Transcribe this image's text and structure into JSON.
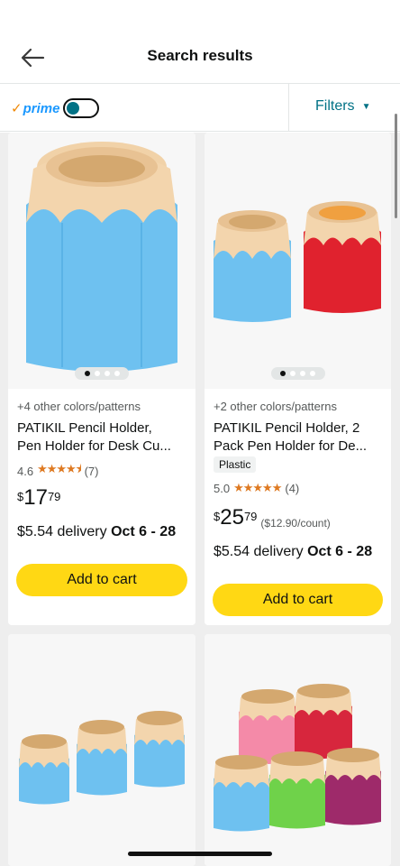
{
  "header": {
    "title": "Search results"
  },
  "filterbar": {
    "prime_check": "✓",
    "prime_label": "prime",
    "filters_label": "Filters"
  },
  "products": [
    {
      "variants": "+4 other colors/patterns",
      "title_line1": "PATIKIL Pencil Holder,",
      "title_line2": "Pen Holder for Desk Cu...",
      "rating": "4.6",
      "stars": "★★★★⯨",
      "reviews": "(7)",
      "price_currency": "$",
      "price_whole": "17",
      "price_fraction": "79",
      "delivery_prefix": "$5.54 delivery ",
      "delivery_dates": "Oct 6 - 28",
      "add_to_cart": "Add to cart"
    },
    {
      "variants": "+2 other colors/patterns",
      "title_line1": "PATIKIL Pencil Holder, 2",
      "title_line2": "Pack Pen Holder for De...",
      "badge": "Plastic",
      "rating": "5.0",
      "stars": "★★★★★",
      "reviews": "(4)",
      "price_currency": "$",
      "price_whole": "25",
      "price_fraction": "79",
      "unit_price": "($12.90/count)",
      "delivery_prefix": "$5.54 delivery ",
      "delivery_dates": "Oct 6 - 28",
      "add_to_cart": "Add to cart"
    }
  ],
  "colors": {
    "accent_teal": "#007185",
    "prime_blue": "#1a98ff",
    "star_orange": "#de7921",
    "cart_yellow": "#ffd814",
    "holder_blue": "#6ec1f0",
    "holder_red": "#e0222e",
    "holder_beige": "#f3d5ad"
  },
  "icons": [
    "back-arrow-icon",
    "chevron-down-icon",
    "prime-toggle"
  ]
}
